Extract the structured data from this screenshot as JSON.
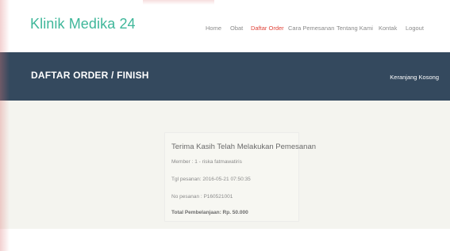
{
  "brand": {
    "name": "Klinik Medika 24",
    "color": "#3fb79a"
  },
  "nav": {
    "items": [
      {
        "label": "Home",
        "active": false
      },
      {
        "label": "Obat",
        "active": false
      },
      {
        "label": "Daftar Order",
        "active": true
      },
      {
        "label": "Cara Pemesanan",
        "active": false
      },
      {
        "label": "Tentang Kami",
        "active": false
      },
      {
        "label": "Kontak",
        "active": false
      },
      {
        "label": "Logout",
        "active": false
      }
    ],
    "active_color": "#e0443a"
  },
  "header": {
    "title": "DAFTAR ORDER / FINISH",
    "cart_label": "Keranjang Kosong",
    "background": "#34495e"
  },
  "order": {
    "thanks": "Terima Kasih Telah Melakukan Pemesanan",
    "member": "Member : 1 - riska fatmawatiris",
    "date": "Tgl pesanan: 2016-05-21 07:50:35",
    "number": "No pesanan : P160521001",
    "total": "Total Pembelanjaan: Rp. 50.000"
  }
}
